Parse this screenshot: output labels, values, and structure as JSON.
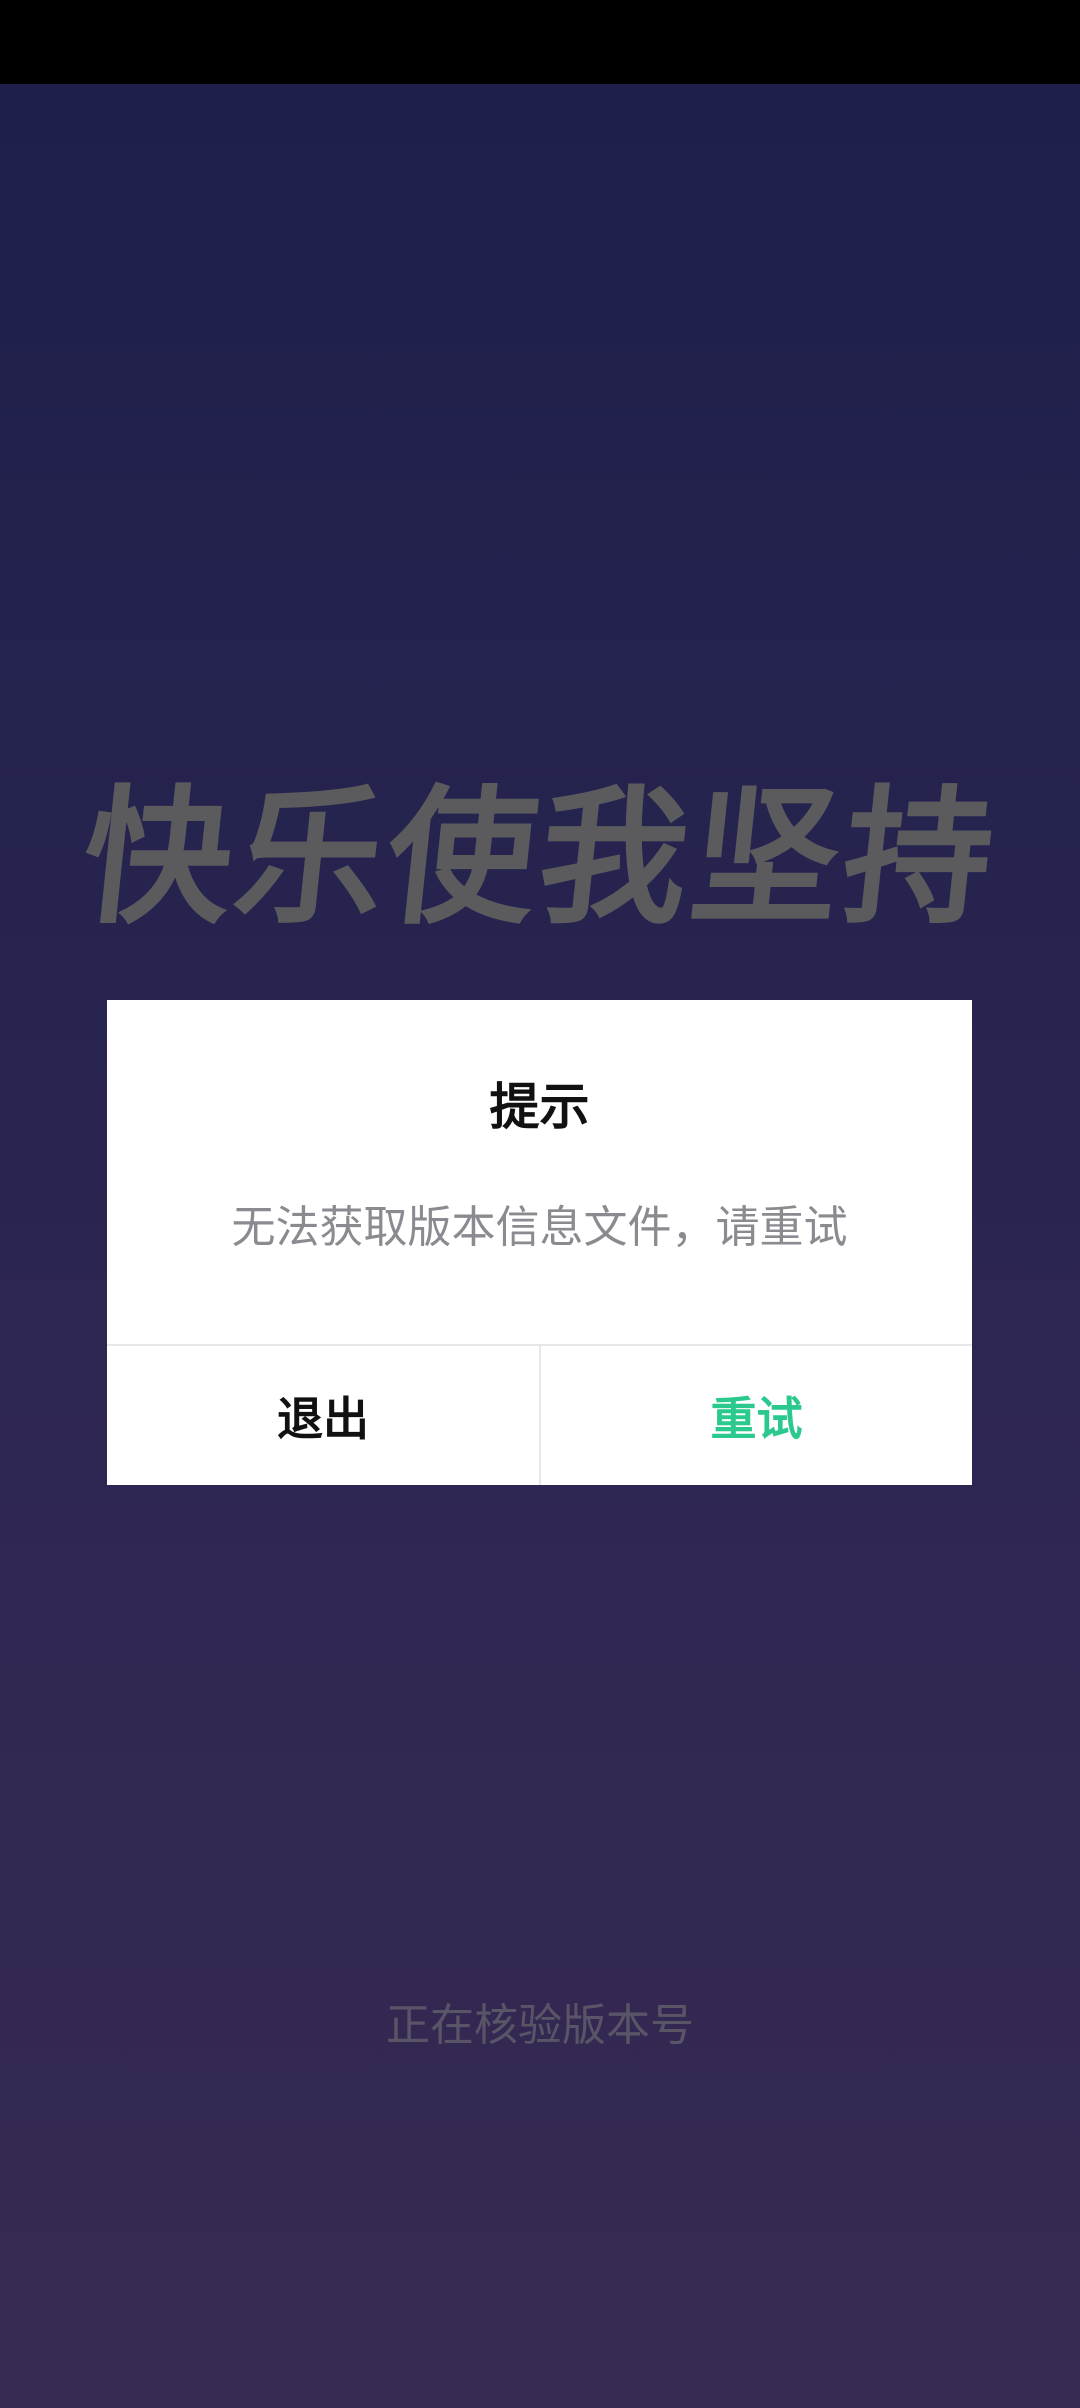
{
  "background": {
    "slogan": "快乐使我坚持",
    "loading_text": "正在核验版本号"
  },
  "dialog": {
    "title": "提示",
    "message": "无法获取版本信息文件，请重试",
    "buttons": {
      "exit_label": "退出",
      "retry_label": "重试"
    }
  },
  "colors": {
    "accent": "#2cc98e",
    "dialog_bg": "#ffffff",
    "screen_gradient_top": "#1e1f4b",
    "screen_gradient_bottom": "#372a52"
  }
}
